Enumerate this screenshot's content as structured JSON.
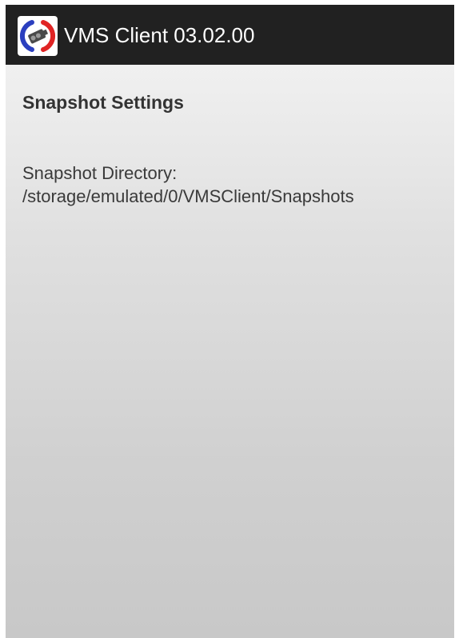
{
  "action_bar": {
    "title": "VMS Client 03.02.00",
    "icon": "camera-app-icon",
    "colors": {
      "background": "#212121",
      "title_text": "#ffffff",
      "icon_arc_left": "#2b3fbf",
      "icon_arc_right": "#e02424"
    }
  },
  "settings": {
    "section_title": "Snapshot Settings",
    "snapshot_directory": {
      "label": "Snapshot Directory:",
      "value": "/storage/emulated/0/VMSClient/Snapshots"
    }
  }
}
